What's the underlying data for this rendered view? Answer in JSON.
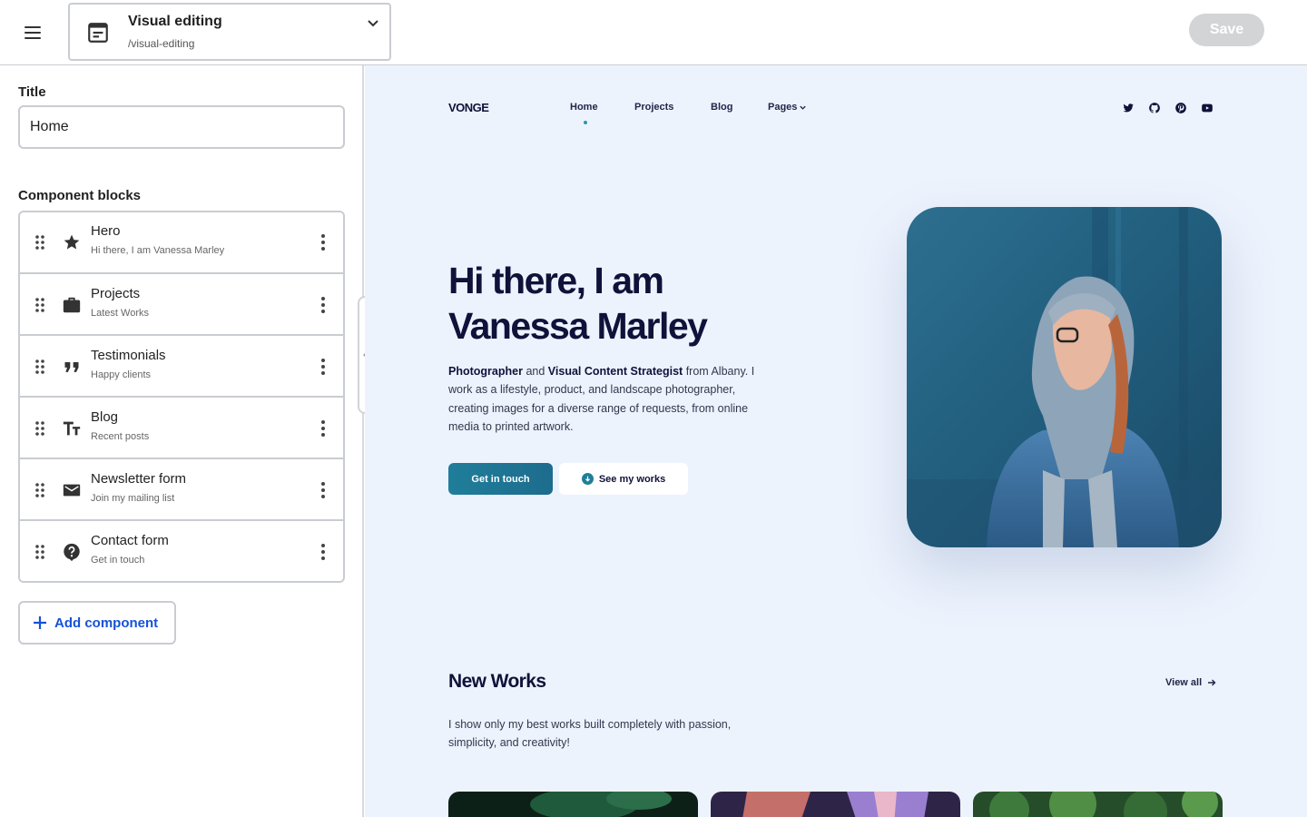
{
  "topbar": {
    "menu_icon": "hamburger-menu-icon",
    "page_select": {
      "icon": "page-layout-icon",
      "title": "Visual editing",
      "path": "/visual-editing",
      "chevron_icon": "chevron-down-icon"
    },
    "save_label": "Save",
    "save_state": "disabled"
  },
  "editor": {
    "title_label": "Title",
    "title_value": "Home",
    "blocks_label": "Component blocks",
    "blocks": [
      {
        "name": "Hero",
        "subtitle": "Hi there, I am Vanessa Marley",
        "icon": "star-icon"
      },
      {
        "name": "Projects",
        "subtitle": "Latest Works",
        "icon": "briefcase-icon"
      },
      {
        "name": "Testimonials",
        "subtitle": "Happy clients",
        "icon": "quote-icon"
      },
      {
        "name": "Blog",
        "subtitle": "Recent posts",
        "icon": "text-format-icon"
      },
      {
        "name": "Newsletter form",
        "subtitle": "Join my mailing list",
        "icon": "envelope-icon"
      },
      {
        "name": "Contact form",
        "subtitle": "Get in touch",
        "icon": "help-question-icon"
      }
    ],
    "add_label": "Add component"
  },
  "preview": {
    "logo": "VONGE",
    "nav": [
      "Home",
      "Projects",
      "Blog",
      "Pages"
    ],
    "active_nav": "Home",
    "social_icons": [
      "twitter-icon",
      "github-icon",
      "pinterest-icon",
      "youtube-icon"
    ],
    "hero": {
      "title_line1": "Hi there, I am",
      "title_line2": "Vanessa Marley",
      "desc_bold1": "Photographer",
      "desc_and": "and",
      "desc_bold2": "Visual Content Strategist",
      "desc_rest": "from Albany. I work as a lifestyle, product, and landscape photographer, creating images for a diverse range of requests, from online media to printed artwork.",
      "cta_primary": "Get in touch",
      "cta_secondary": "See my works"
    },
    "works": {
      "title": "New Works",
      "view_all": "View all",
      "description": "I show only my best works built completely with passion, simplicity, and creativity!"
    },
    "colors": {
      "accent": "#1f7e9a",
      "heading": "#10123a",
      "background": "#edf3fd",
      "link": "#1652d6"
    }
  }
}
